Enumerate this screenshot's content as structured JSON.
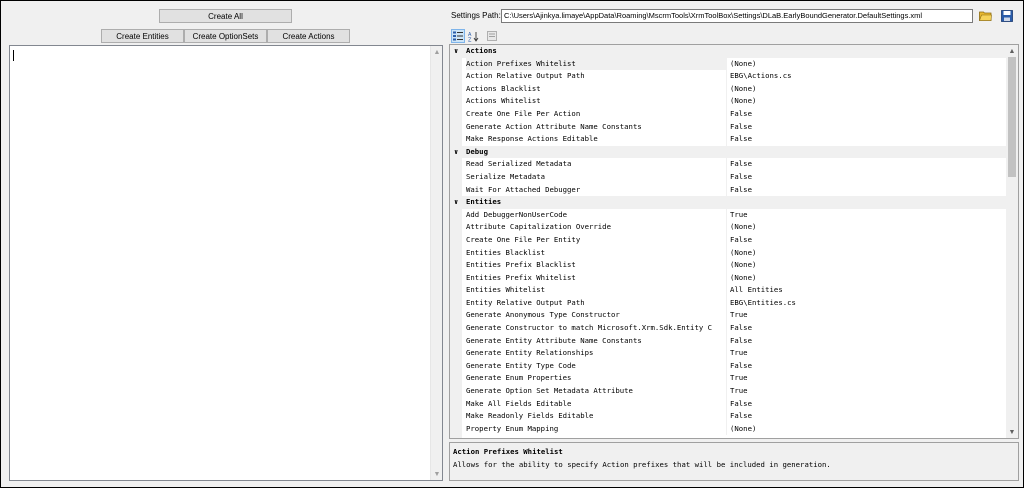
{
  "buttons": {
    "create_all": "Create All",
    "create_entities": "Create Entities",
    "create_optionsets": "Create OptionSets",
    "create_actions": "Create Actions"
  },
  "settings": {
    "path_label": "Settings Path:",
    "path_value": "C:\\Users\\Ajinkya.limaye\\AppData\\Roaming\\MscrmTools\\XrmToolBox\\Settings\\DLaB.EarlyBoundGenerator.DefaultSettings.xml"
  },
  "properties": {
    "categories": [
      {
        "name": "Actions",
        "rows": [
          {
            "name": "Action Prefixes Whitelist",
            "value": "(None)"
          },
          {
            "name": "Action Relative Output Path",
            "value": "EBG\\Actions.cs"
          },
          {
            "name": "Actions Blacklist",
            "value": "(None)"
          },
          {
            "name": "Actions Whitelist",
            "value": "(None)"
          },
          {
            "name": "Create One File Per Action",
            "value": "False"
          },
          {
            "name": "Generate Action Attribute Name Constants",
            "value": "False"
          },
          {
            "name": "Make Response Actions Editable",
            "value": "False"
          }
        ]
      },
      {
        "name": "Debug",
        "rows": [
          {
            "name": "Read Serialized Metadata",
            "value": "False"
          },
          {
            "name": "Serialize Metadata",
            "value": "False"
          },
          {
            "name": "Wait For Attached Debugger",
            "value": "False"
          }
        ]
      },
      {
        "name": "Entities",
        "rows": [
          {
            "name": "Add DebuggerNonUserCode",
            "value": "True"
          },
          {
            "name": "Attribute Capitalization Override",
            "value": "(None)"
          },
          {
            "name": "Create One File Per Entity",
            "value": "False"
          },
          {
            "name": "Entities Blacklist",
            "value": "(None)"
          },
          {
            "name": "Entities Prefix Blacklist",
            "value": "(None)"
          },
          {
            "name": "Entities Prefix Whitelist",
            "value": "(None)"
          },
          {
            "name": "Entities Whitelist",
            "value": "All Entities"
          },
          {
            "name": "Entity Relative Output Path",
            "value": "EBG\\Entities.cs"
          },
          {
            "name": "Generate Anonymous Type Constructor",
            "value": "True"
          },
          {
            "name": "Generate Constructor to match Microsoft.Xrm.Sdk.Entity C",
            "value": "False"
          },
          {
            "name": "Generate Entity Attribute Name Constants",
            "value": "False"
          },
          {
            "name": "Generate Entity Relationships",
            "value": "True"
          },
          {
            "name": "Generate Entity Type Code",
            "value": "False"
          },
          {
            "name": "Generate Enum Properties",
            "value": "True"
          },
          {
            "name": "Generate Option Set Metadata Attribute",
            "value": "True"
          },
          {
            "name": "Make All Fields Editable",
            "value": "False"
          },
          {
            "name": "Make Readonly Fields Editable",
            "value": "False"
          },
          {
            "name": "Property Enum Mapping",
            "value": "(None)"
          }
        ]
      }
    ]
  },
  "help": {
    "title": "Action Prefixes Whitelist",
    "description": "Allows for the ability to specify Action prefixes that will be included in generation."
  },
  "icons": {
    "categorized": "categorized-sort-icon",
    "alphabetical": "alphabetical-sort-icon",
    "property_pages": "property-pages-icon",
    "open_folder": "open-folder-icon",
    "save": "save-icon"
  },
  "colors": {
    "window_bg": "#f0f0f0",
    "folder_icon": "#e8b830",
    "save_icon": "#2a5caa"
  }
}
